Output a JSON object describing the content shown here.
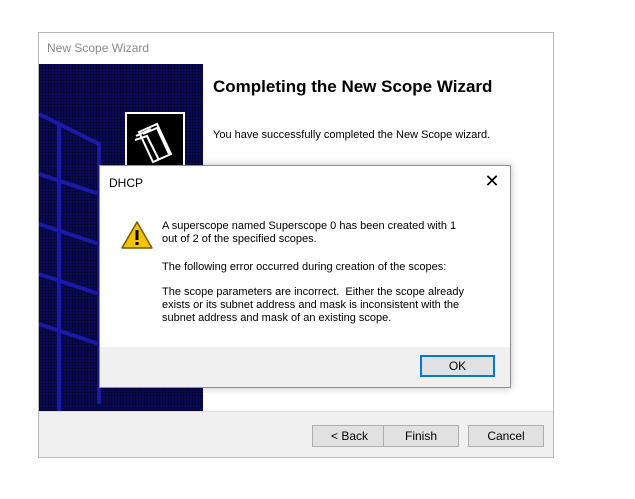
{
  "wizard": {
    "title": "New Scope Wizard",
    "heading": "Completing the New Scope Wizard",
    "message": "You have successfully completed the New Scope wizard.",
    "buttons": {
      "back": "< Back",
      "finish": "Finish",
      "cancel": "Cancel"
    },
    "banner_color": "#0a0a5a"
  },
  "dialog": {
    "title": "DHCP",
    "close_icon": "close-icon",
    "warning_icon": "warning-icon",
    "message_1": "A superscope named Superscope 0 has been created with 1\nout of 2 of the specified scopes.",
    "message_2": "The following error occurred during creation of the scopes:",
    "message_3": "The scope parameters are incorrect.  Either the scope already\nexists or its subnet address and mask is inconsistent with the\nsubnet address and mask of an existing scope.",
    "ok_label": "OK",
    "accent": "#0078d7"
  }
}
